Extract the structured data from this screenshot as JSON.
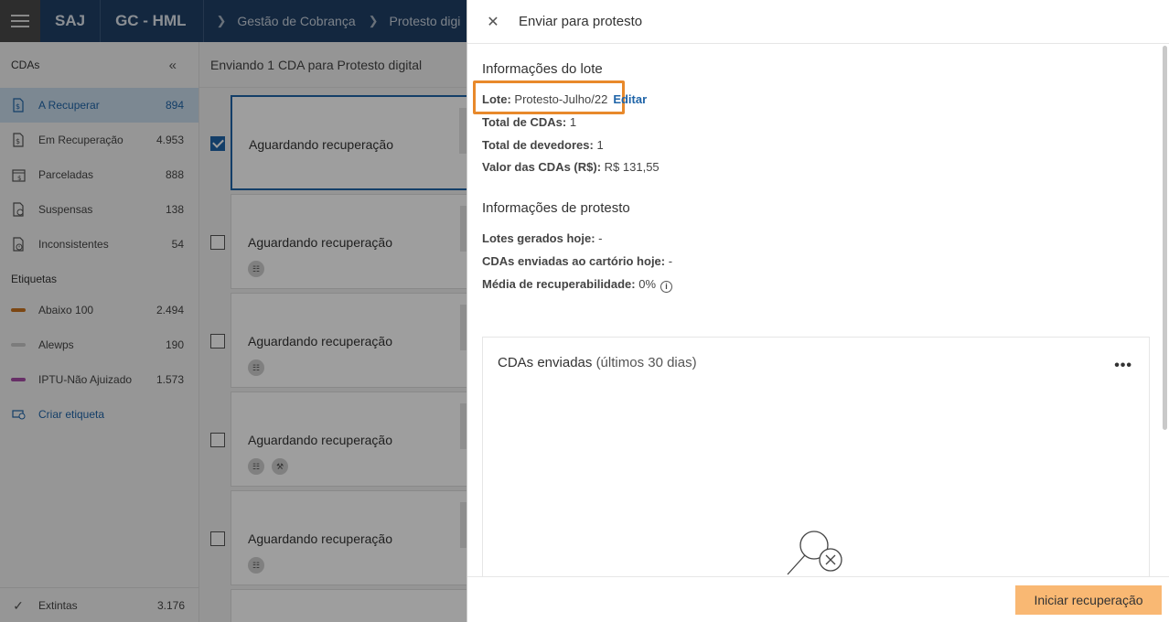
{
  "topbar": {
    "brand": "SAJ",
    "module": "GC - HML",
    "breadcrumb": [
      "Gestão de Cobrança",
      "Protesto digi"
    ]
  },
  "sidebar": {
    "title": "CDAs",
    "items": [
      {
        "label": "A Recuperar",
        "count": "894"
      },
      {
        "label": "Em Recuperação",
        "count": "4.953"
      },
      {
        "label": "Parceladas",
        "count": "888"
      },
      {
        "label": "Suspensas",
        "count": "138"
      },
      {
        "label": "Inconsistentes",
        "count": "54"
      }
    ],
    "tags_title": "Etiquetas",
    "tags": [
      {
        "label": "Abaixo 100",
        "count": "2.494",
        "color": "#c9731f"
      },
      {
        "label": "Alewps",
        "count": "190",
        "color": "#c8c8c8"
      },
      {
        "label": "IPTU-Não Ajuizado",
        "count": "1.573",
        "color": "#a64ca6"
      }
    ],
    "create_tag": "Criar etiqueta",
    "bottom": {
      "label": "Extintas",
      "count": "3.176"
    }
  },
  "main": {
    "header": "Enviando 1 CDA para  Protesto digital",
    "cards": [
      {
        "title": "Aguardando recuperação"
      },
      {
        "title": "Aguardando recuperação"
      },
      {
        "title": "Aguardando recuperação"
      },
      {
        "title": "Aguardando recuperação"
      },
      {
        "title": "Aguardando recuperação"
      }
    ]
  },
  "panel": {
    "title": "Enviar para protesto",
    "lote_section": "Informações do lote",
    "lote_label": "Lote:",
    "lote_value": "Protesto-Julho/22",
    "edit": "Editar",
    "total_cdas_label": "Total de CDAs:",
    "total_cdas": "1",
    "total_devedores_label": "Total de devedores:",
    "total_devedores": "1",
    "valor_label": "Valor das CDAs (R$):",
    "valor": "R$ 131,55",
    "protesto_section": "Informações de protesto",
    "lotes_hoje_label": "Lotes gerados hoje:",
    "lotes_hoje": "-",
    "cdas_cartorio_label": "CDAs enviadas ao cartório hoje:",
    "cdas_cartorio": "-",
    "media_label": "Média de recuperabilidade:",
    "media": "0%",
    "chart_title": "CDAs enviadas",
    "chart_subtitle": "(últimos 30 dias)",
    "more": "•••",
    "submit": "Iniciar recuperação"
  }
}
